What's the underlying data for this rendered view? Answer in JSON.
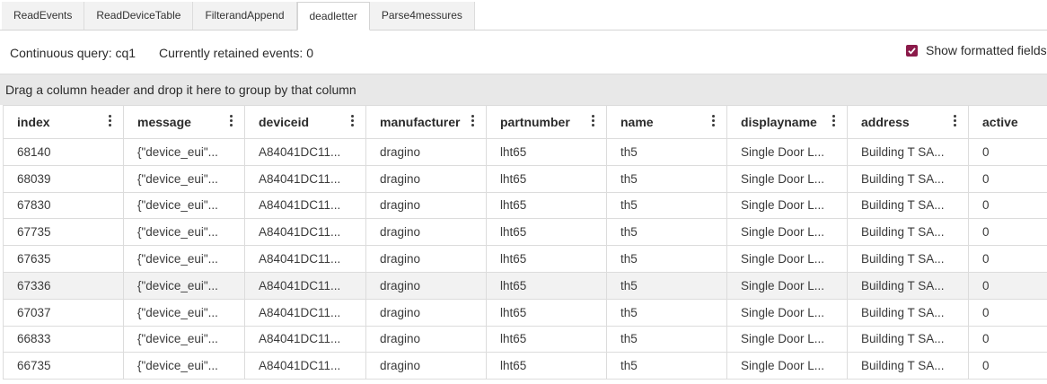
{
  "tabs": [
    {
      "label": "ReadEvents"
    },
    {
      "label": "ReadDeviceTable"
    },
    {
      "label": "FilterandAppend"
    },
    {
      "label": "deadletter"
    },
    {
      "label": "Parse4messures"
    }
  ],
  "toolbar": {
    "continuous_query": "Continuous query: cq1",
    "retained_events": "Currently retained events: 0",
    "show_formatted": "Show formatted fields"
  },
  "group_bar": "Drag a column header and drop it here to group by that column",
  "columns": [
    "index",
    "message",
    "deviceid",
    "manufacturer",
    "partnumber",
    "name",
    "displayname",
    "address",
    "active"
  ],
  "rows": [
    [
      "68140",
      "{\"device_eui\"...",
      "A84041DC11...",
      "dragino",
      "lht65",
      "th5",
      "Single Door L...",
      "Building T SA...",
      "0"
    ],
    [
      "68039",
      "{\"device_eui\"...",
      "A84041DC11...",
      "dragino",
      "lht65",
      "th5",
      "Single Door L...",
      "Building T SA...",
      "0"
    ],
    [
      "67830",
      "{\"device_eui\"...",
      "A84041DC11...",
      "dragino",
      "lht65",
      "th5",
      "Single Door L...",
      "Building T SA...",
      "0"
    ],
    [
      "67735",
      "{\"device_eui\"...",
      "A84041DC11...",
      "dragino",
      "lht65",
      "th5",
      "Single Door L...",
      "Building T SA...",
      "0"
    ],
    [
      "67635",
      "{\"device_eui\"...",
      "A84041DC11...",
      "dragino",
      "lht65",
      "th5",
      "Single Door L...",
      "Building T SA...",
      "0"
    ],
    [
      "67336",
      "{\"device_eui\"...",
      "A84041DC11...",
      "dragino",
      "lht65",
      "th5",
      "Single Door L...",
      "Building T SA...",
      "0"
    ],
    [
      "67037",
      "{\"device_eui\"...",
      "A84041DC11...",
      "dragino",
      "lht65",
      "th5",
      "Single Door L...",
      "Building T SA...",
      "0"
    ],
    [
      "66833",
      "{\"device_eui\"...",
      "A84041DC11...",
      "dragino",
      "lht65",
      "th5",
      "Single Door L...",
      "Building T SA...",
      "0"
    ],
    [
      "66735",
      "{\"device_eui\"...",
      "A84041DC11...",
      "dragino",
      "lht65",
      "th5",
      "Single Door L...",
      "Building T SA...",
      "0"
    ]
  ],
  "colors": {
    "accent": "#8b1a4a",
    "highlight_row": "#f2f2f2",
    "group_bar": "#e8e8e8"
  }
}
